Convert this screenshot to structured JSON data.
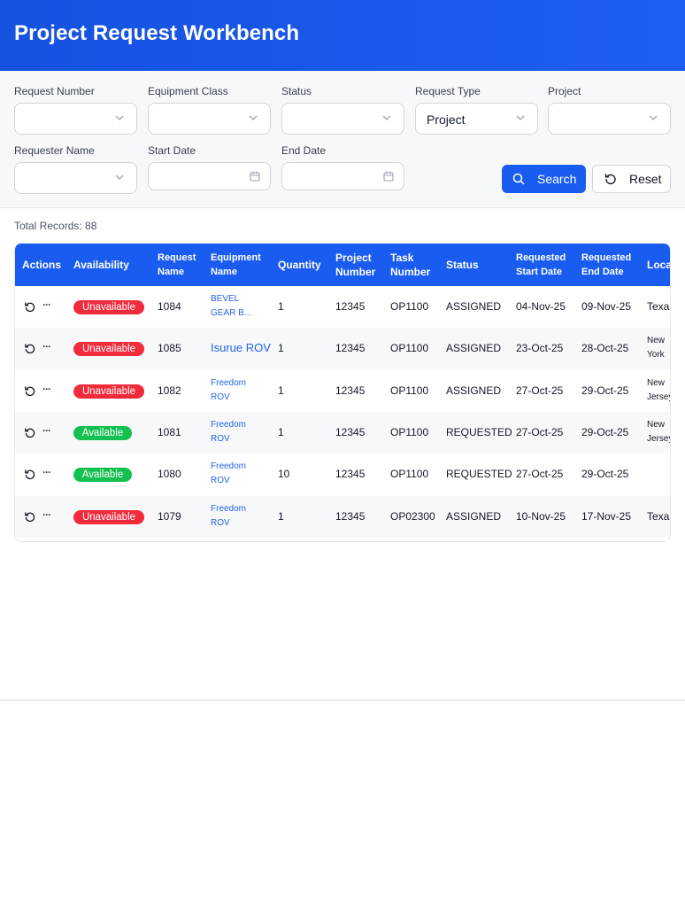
{
  "header": {
    "title": "Project Request Workbench"
  },
  "filters": {
    "request_number": {
      "label": "Request Number",
      "value": ""
    },
    "equipment_class": {
      "label": "Equipment Class",
      "value": ""
    },
    "status": {
      "label": "Status",
      "value": ""
    },
    "request_type": {
      "label": "Request Type",
      "value": "Project"
    },
    "project": {
      "label": "Project",
      "value": ""
    },
    "requester_name": {
      "label": "Requester Name",
      "value": ""
    },
    "start_date": {
      "label": "Start Date",
      "value": ""
    },
    "end_date": {
      "label": "End Date",
      "value": ""
    },
    "search_label": "Search",
    "reset_label": "Reset"
  },
  "total_records": "Total Records: 88",
  "table": {
    "headers": {
      "actions": "Actions",
      "availability": "Availability",
      "request_name_1": "Request",
      "request_name_2": "Name",
      "equipment_name_1": "Equipment",
      "equipment_name_2": "Name",
      "quantity": "Quantity",
      "project_number_1": "Project",
      "project_number_2": "Number",
      "task_number_1": "Task",
      "task_number_2": "Number",
      "status": "Status",
      "req_start_1": "Requested",
      "req_start_2": "Start Date",
      "req_end_1": "Requested",
      "req_end_2": "End Date",
      "location": "Loca"
    },
    "rows": [
      {
        "availability": "Unavailable",
        "avail_color": "#ef2b3c",
        "request": "1084",
        "equip_1": "BEVEL",
        "equip_2": "GEAR B...",
        "qty": "1",
        "project": "12345",
        "task": "OP1100",
        "status": "ASSIGNED",
        "start": "04-Nov-25",
        "end": "09-Nov-25",
        "loc_1": "Texas",
        "loc_2": ""
      },
      {
        "availability": "Unavailable",
        "avail_color": "#ef2b3c",
        "request": "1085",
        "equip_1": "Isurue ROV",
        "equip_2": "",
        "qty": "1",
        "project": "12345",
        "task": "OP1100",
        "status": "ASSIGNED",
        "start": "23-Oct-25",
        "end": "28-Oct-25",
        "loc_1": "New",
        "loc_2": "York"
      },
      {
        "availability": "Unavailable",
        "avail_color": "#ef2b3c",
        "request": "1082",
        "equip_1": "Freedom",
        "equip_2": "ROV",
        "qty": "1",
        "project": "12345",
        "task": "OP1100",
        "status": "ASSIGNED",
        "start": "27-Oct-25",
        "end": "29-Oct-25",
        "loc_1": "New",
        "loc_2": "Jersey"
      },
      {
        "availability": "Available",
        "avail_color": "#16c050",
        "request": "1081",
        "equip_1": "Freedom",
        "equip_2": "ROV",
        "qty": "1",
        "project": "12345",
        "task": "OP1100",
        "status": "REQUESTED",
        "start": "27-Oct-25",
        "end": "29-Oct-25",
        "loc_1": "New",
        "loc_2": "Jersey"
      },
      {
        "availability": "Available",
        "avail_color": "#16c050",
        "request": "1080",
        "equip_1": "Freedom",
        "equip_2": "ROV",
        "qty": "10",
        "project": "12345",
        "task": "OP1100",
        "status": "REQUESTED",
        "start": "27-Oct-25",
        "end": "29-Oct-25",
        "loc_1": "",
        "loc_2": ""
      },
      {
        "availability": "Unavailable",
        "avail_color": "#ef2b3c",
        "request": "1079",
        "equip_1": "Freedom",
        "equip_2": "ROV",
        "qty": "1",
        "project": "12345",
        "task": "OP02300",
        "status": "ASSIGNED",
        "start": "10-Nov-25",
        "end": "17-Nov-25",
        "loc_1": "Texas",
        "loc_2": ""
      }
    ]
  },
  "icons": {
    "chevron": "chevron-down-icon",
    "calendar": "calendar-icon",
    "search": "search-icon",
    "reset": "reset-icon",
    "history": "history-icon",
    "more": "more-icon"
  },
  "colors": {
    "primary": "#1a5cf0",
    "unavailable": "#ef2b3c",
    "available": "#16c050",
    "link": "#2563eb"
  }
}
